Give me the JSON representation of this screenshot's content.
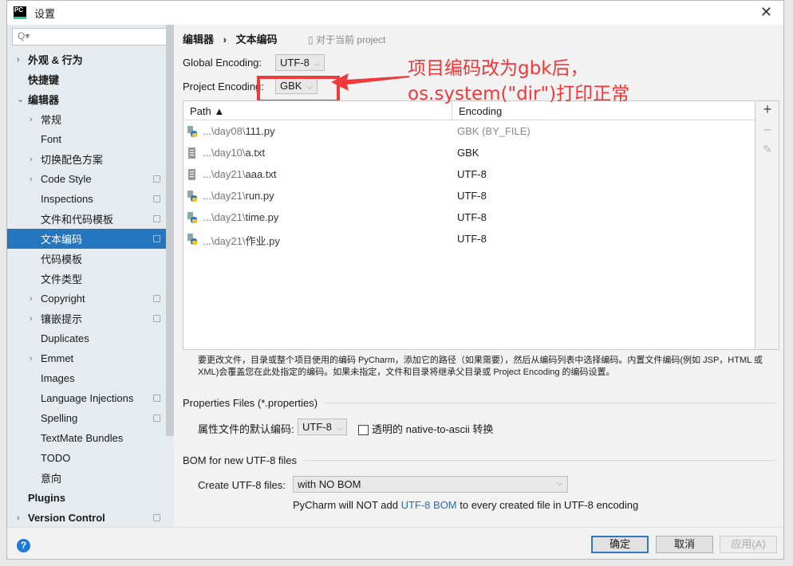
{
  "window": {
    "title": "设置",
    "logo": "PC"
  },
  "search": {
    "placeholder": "Q▾"
  },
  "sidebar": {
    "items": [
      {
        "label": "外观 & 行为",
        "level": 0,
        "arrow": "›",
        "bold": true
      },
      {
        "label": "快捷键",
        "level": 0,
        "bold": true
      },
      {
        "label": "编辑器",
        "level": 0,
        "arrow": "⌄",
        "bold": true
      },
      {
        "label": "常规",
        "level": 1,
        "arrow": "›"
      },
      {
        "label": "Font",
        "level": 1
      },
      {
        "label": "切换配色方案",
        "level": 1,
        "arrow": "›"
      },
      {
        "label": "Code Style",
        "level": 1,
        "arrow": "›",
        "copy": true
      },
      {
        "label": "Inspections",
        "level": 1,
        "copy": true
      },
      {
        "label": "文件和代码模板",
        "level": 1,
        "copy": true
      },
      {
        "label": "文本编码",
        "level": 1,
        "copy": true,
        "selected": true
      },
      {
        "label": "代码模板",
        "level": 1
      },
      {
        "label": "文件类型",
        "level": 1
      },
      {
        "label": "Copyright",
        "level": 1,
        "arrow": "›",
        "copy": true
      },
      {
        "label": "镶嵌提示",
        "level": 1,
        "arrow": "›",
        "copy": true
      },
      {
        "label": "Duplicates",
        "level": 1
      },
      {
        "label": "Emmet",
        "level": 1,
        "arrow": "›"
      },
      {
        "label": "Images",
        "level": 1
      },
      {
        "label": "Language Injections",
        "level": 1,
        "copy": true
      },
      {
        "label": "Spelling",
        "level": 1,
        "copy": true
      },
      {
        "label": "TextMate Bundles",
        "level": 1
      },
      {
        "label": "TODO",
        "level": 1
      },
      {
        "label": "意向",
        "level": 1
      },
      {
        "label": "Plugins",
        "level": 0,
        "bold": true
      },
      {
        "label": "Version Control",
        "level": 0,
        "arrow": "›",
        "bold": true,
        "copy": true
      }
    ]
  },
  "main": {
    "breadcrumb": [
      "编辑器",
      "›",
      "文本编码"
    ],
    "scope_note": "对于当前 project",
    "global_encoding": {
      "label": "Global Encoding:",
      "value": "UTF-8"
    },
    "project_encoding": {
      "label": "Project Encoding:",
      "value": "GBK"
    },
    "table": {
      "headers": [
        "Path ▲",
        "Encoding"
      ],
      "rows": [
        {
          "prefix": "...\\day08\\",
          "name": "111.py",
          "encoding": "GBK (BY_FILE)",
          "type": "py",
          "grey": true
        },
        {
          "prefix": "...\\day10\\",
          "name": "a.txt",
          "encoding": "GBK",
          "type": "txt"
        },
        {
          "prefix": "...\\day21\\",
          "name": "aaa.txt",
          "encoding": "UTF-8",
          "type": "txt"
        },
        {
          "prefix": "...\\day21\\",
          "name": "run.py",
          "encoding": "UTF-8",
          "type": "py"
        },
        {
          "prefix": "...\\day21\\",
          "name": "time.py",
          "encoding": "UTF-8",
          "type": "py"
        },
        {
          "prefix": "...\\day21\\",
          "name": "作业.py",
          "encoding": "UTF-8",
          "type": "py"
        }
      ],
      "tools": [
        "+",
        "−",
        "✎"
      ]
    },
    "help_text": "要更改文件，目录或整个项目使用的编码 PyCharm，添加它的路径（如果需要），然后从编码列表中选择编码。内置文件编码(例如 JSP，HTML 或 XML)会覆盖您在此处指定的编码。如果未指定，文件和目录将继承父目录或 Project Encoding 的编码设置。",
    "properties": {
      "section": "Properties Files (*.properties)",
      "label": "属性文件的默认编码:",
      "value": "UTF-8",
      "checkbox_label": "透明的 native-to-ascii 转换",
      "checked": false
    },
    "bom": {
      "section": "BOM for new UTF-8 files",
      "label": "Create UTF-8 files:",
      "value": "with NO BOM",
      "note_pre": "PyCharm will NOT add ",
      "note_link": "UTF-8 BOM",
      "note_post": " to every created file in UTF-8 encoding"
    }
  },
  "footer": {
    "help": "?",
    "ok": "确定",
    "cancel": "取消",
    "apply": "应用(A)"
  },
  "annotation": {
    "line1": "项目编码改为gbk后，",
    "line2": "os.system(\"dir\")打印正常",
    "color": "#ee3a3a"
  },
  "colors": {
    "selection": "#2675bf",
    "link": "#2470b3",
    "sidebar": "#e6ebf0"
  }
}
